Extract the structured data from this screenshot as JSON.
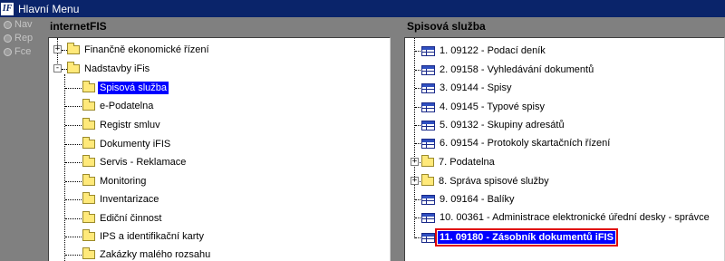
{
  "window": {
    "title": "Hlavní Menu",
    "logo_text": "IF"
  },
  "side_radios": [
    "Nav",
    "Rep",
    "Fce"
  ],
  "left_panel": {
    "title": "internetFIS",
    "items": [
      {
        "label": "Finančně ekonomické řízení",
        "level": 0,
        "expander": "+"
      },
      {
        "label": "Nadstavby iFis",
        "level": 0,
        "expander": "-"
      },
      {
        "label": "Spisová služba",
        "level": 1,
        "selected": true
      },
      {
        "label": "e-Podatelna",
        "level": 1
      },
      {
        "label": "Registr smluv",
        "level": 1
      },
      {
        "label": "Dokumenty iFIS",
        "level": 1
      },
      {
        "label": "Servis - Reklamace",
        "level": 1
      },
      {
        "label": "Monitoring",
        "level": 1
      },
      {
        "label": "Inventarizace",
        "level": 1
      },
      {
        "label": "Ediční činnost",
        "level": 1
      },
      {
        "label": "IPS a identifikační karty",
        "level": 1
      },
      {
        "label": "Zakázky malého rozsahu",
        "level": 1
      }
    ]
  },
  "right_panel": {
    "title": "Spisová služba",
    "items": [
      {
        "label": "1. 09122 - Podací deník",
        "icon": "grid"
      },
      {
        "label": "2. 09158 - Vyhledávání dokumentů",
        "icon": "grid"
      },
      {
        "label": "3. 09144 - Spisy",
        "icon": "grid"
      },
      {
        "label": "4. 09145 - Typové spisy",
        "icon": "grid"
      },
      {
        "label": "5. 09132 - Skupiny adresátů",
        "icon": "grid"
      },
      {
        "label": "6. 09154 - Protokoly skartačních řízení",
        "icon": "grid"
      },
      {
        "label": "7. Podatelna",
        "icon": "folder",
        "expander": "+"
      },
      {
        "label": "8. Správa spisové služby",
        "icon": "folder",
        "expander": "+"
      },
      {
        "label": "9. 09164 - Balíky",
        "icon": "grid"
      },
      {
        "label": "10. 00361 - Administrace elektronické úřední desky - správce",
        "icon": "grid"
      },
      {
        "label": "11. 09180 - Zásobník dokumentů iFIS",
        "icon": "grid",
        "selected": true
      }
    ]
  }
}
